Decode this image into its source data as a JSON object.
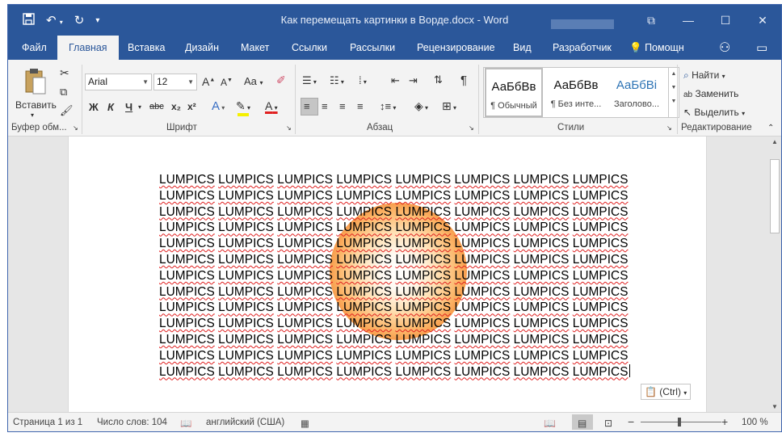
{
  "window": {
    "title": "Как перемещать картинки в Ворде.docx - Word",
    "controls": [
      "restore-ribbon-icon",
      "minimize-icon",
      "maximize-icon",
      "close-icon"
    ]
  },
  "qat": {
    "icons": [
      "save-icon",
      "undo-icon",
      "redo-icon",
      "customize-qat-icon"
    ]
  },
  "tabs": {
    "items": [
      "Файл",
      "Главная",
      "Вставка",
      "Дизайн",
      "Макет",
      "Ссылки",
      "Рассылки",
      "Рецензирование",
      "Вид",
      "Разработчик"
    ],
    "active": "Главная",
    "tell_me": "Помощн"
  },
  "ribbon": {
    "clipboard": {
      "paste": "Вставить",
      "label": "Буфер обм..."
    },
    "font": {
      "name": "Arial",
      "size": "12",
      "bold": "Ж",
      "italic": "К",
      "underline": "Ч",
      "strike": "abc",
      "subscript": "x₂",
      "superscript": "x²",
      "grow": "A",
      "shrink": "A",
      "case": "Aa",
      "label": "Шрифт"
    },
    "paragraph": {
      "show_marks": "¶",
      "label": "Абзац"
    },
    "styles": {
      "items": [
        {
          "sample": "АаБбВв",
          "name": "¶ Обычный"
        },
        {
          "sample": "АаБбВв",
          "name": "¶ Без инте..."
        },
        {
          "sample": "АаБбВі",
          "name": "Заголово..."
        }
      ],
      "label": "Стили"
    },
    "editing": {
      "find": "Найти",
      "replace": "Заменить",
      "select": "Выделить",
      "label": "Редактирование"
    }
  },
  "document": {
    "lines": [
      "LUMPICS LUMPICS LUMPICS LUMPICS LUMPICS LUMPICS LUMPICS LUMPICS",
      "LUMPICS LUMPICS LUMPICS LUMPICS LUMPICS LUMPICS LUMPICS LUMPICS",
      "LUMPICS LUMPICS LUMPICS LUMPICS LUMPICS LUMPICS LUMPICS LUMPICS",
      "LUMPICS LUMPICS LUMPICS LUMPICS LUMPICS LUMPICS LUMPICS LUMPICS",
      "LUMPICS LUMPICS LUMPICS LUMPICS LUMPICS LUMPICS LUMPICS LUMPICS",
      "LUMPICS LUMPICS LUMPICS LUMPICS LUMPICS LUMPICS LUMPICS LUMPICS",
      "LUMPICS LUMPICS LUMPICS LUMPICS LUMPICS LUMPICS LUMPICS LUMPICS",
      "LUMPICS LUMPICS LUMPICS LUMPICS LUMPICS LUMPICS LUMPICS LUMPICS",
      "LUMPICS LUMPICS LUMPICS LUMPICS LUMPICS LUMPICS LUMPICS LUMPICS",
      "LUMPICS LUMPICS LUMPICS LUMPICS LUMPICS LUMPICS LUMPICS LUMPICS",
      "LUMPICS LUMPICS LUMPICS LUMPICS LUMPICS LUMPICS LUMPICS LUMPICS",
      "LUMPICS LUMPICS LUMPICS LUMPICS LUMPICS LUMPICS LUMPICS LUMPICS",
      "LUMPICS LUMPICS LUMPICS LUMPICS LUMPICS LUMPICS LUMPICS LUMPICS"
    ],
    "paste_options": "(Ctrl)"
  },
  "statusbar": {
    "page": "Страница 1 из 1",
    "words": "Число слов: 104",
    "language": "английский (США)",
    "zoom": "100 %",
    "zoom_percent": 100
  },
  "colors": {
    "accent": "#2b579a",
    "spellcheck": "#e02020",
    "picture": "#f07800"
  }
}
